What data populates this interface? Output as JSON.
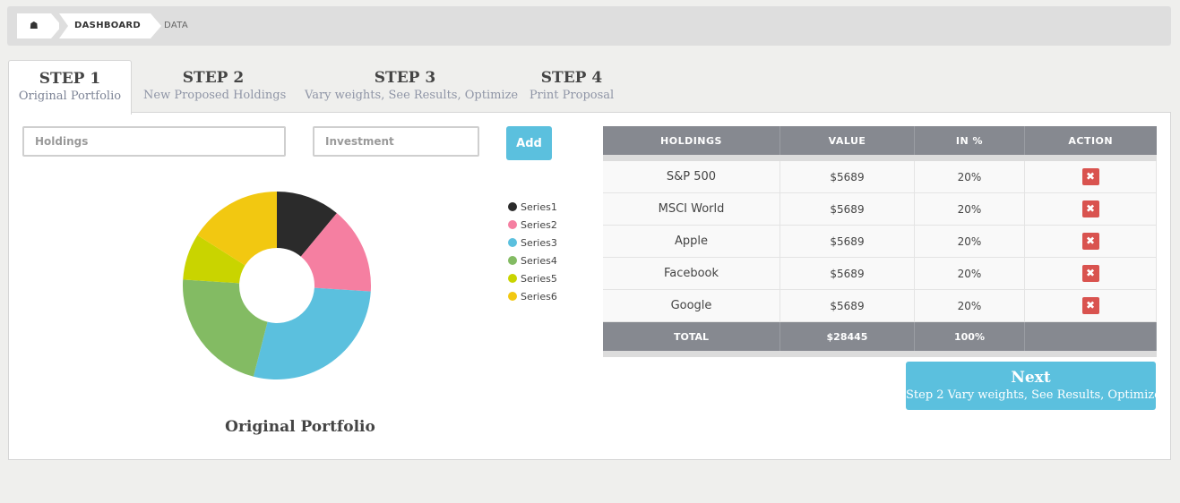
{
  "breadcrumb": {
    "home_icon": "home-icon",
    "items": [
      "DASHBOARD",
      "DATA"
    ]
  },
  "tabs": [
    {
      "step": "STEP 1",
      "label": "Original Portfolio",
      "active": true
    },
    {
      "step": "STEP 2",
      "label": "New Proposed Holdings",
      "active": false
    },
    {
      "step": "STEP 3",
      "label": "Vary weights, See Results, Optimize",
      "active": false
    },
    {
      "step": "STEP 4",
      "label": "Print Proposal",
      "active": false
    }
  ],
  "form": {
    "holdings_placeholder": "Holdings",
    "investment_placeholder": "Investment",
    "add_label": "Add"
  },
  "chart_data": {
    "type": "pie",
    "donut": true,
    "title": "Original Portfolio",
    "series": [
      {
        "name": "Series1",
        "value": 11,
        "color": "#2b2b2b"
      },
      {
        "name": "Series2",
        "value": 15,
        "color": "#f57fa1"
      },
      {
        "name": "Series3",
        "value": 28,
        "color": "#5bc0de"
      },
      {
        "name": "Series4",
        "value": 22,
        "color": "#83bb63"
      },
      {
        "name": "Series5",
        "value": 8,
        "color": "#c9d400"
      },
      {
        "name": "Series6",
        "value": 16,
        "color": "#f2c811"
      }
    ],
    "legend_position": "right"
  },
  "table": {
    "headers": [
      "HOLDINGS",
      "VALUE",
      "IN %",
      "ACTION"
    ],
    "rows": [
      {
        "name": "S&P 500",
        "value": "$5689",
        "pct": "20%"
      },
      {
        "name": "MSCI World",
        "value": "$5689",
        "pct": "20%"
      },
      {
        "name": "Apple",
        "value": "$5689",
        "pct": "20%"
      },
      {
        "name": "Facebook",
        "value": "$5689",
        "pct": "20%"
      },
      {
        "name": "Google",
        "value": "$5689",
        "pct": "20%"
      }
    ],
    "total": {
      "label": "TOTAL",
      "value": "$28445",
      "pct": "100%"
    },
    "delete_icon": "close-icon",
    "delete_color": "#d9534f"
  },
  "next_button": {
    "title": "Next",
    "subtitle": "Step 2 Vary weights, See Results, Optimize"
  },
  "colors": {
    "accent": "#5bc0de",
    "header_gray": "#868990"
  }
}
